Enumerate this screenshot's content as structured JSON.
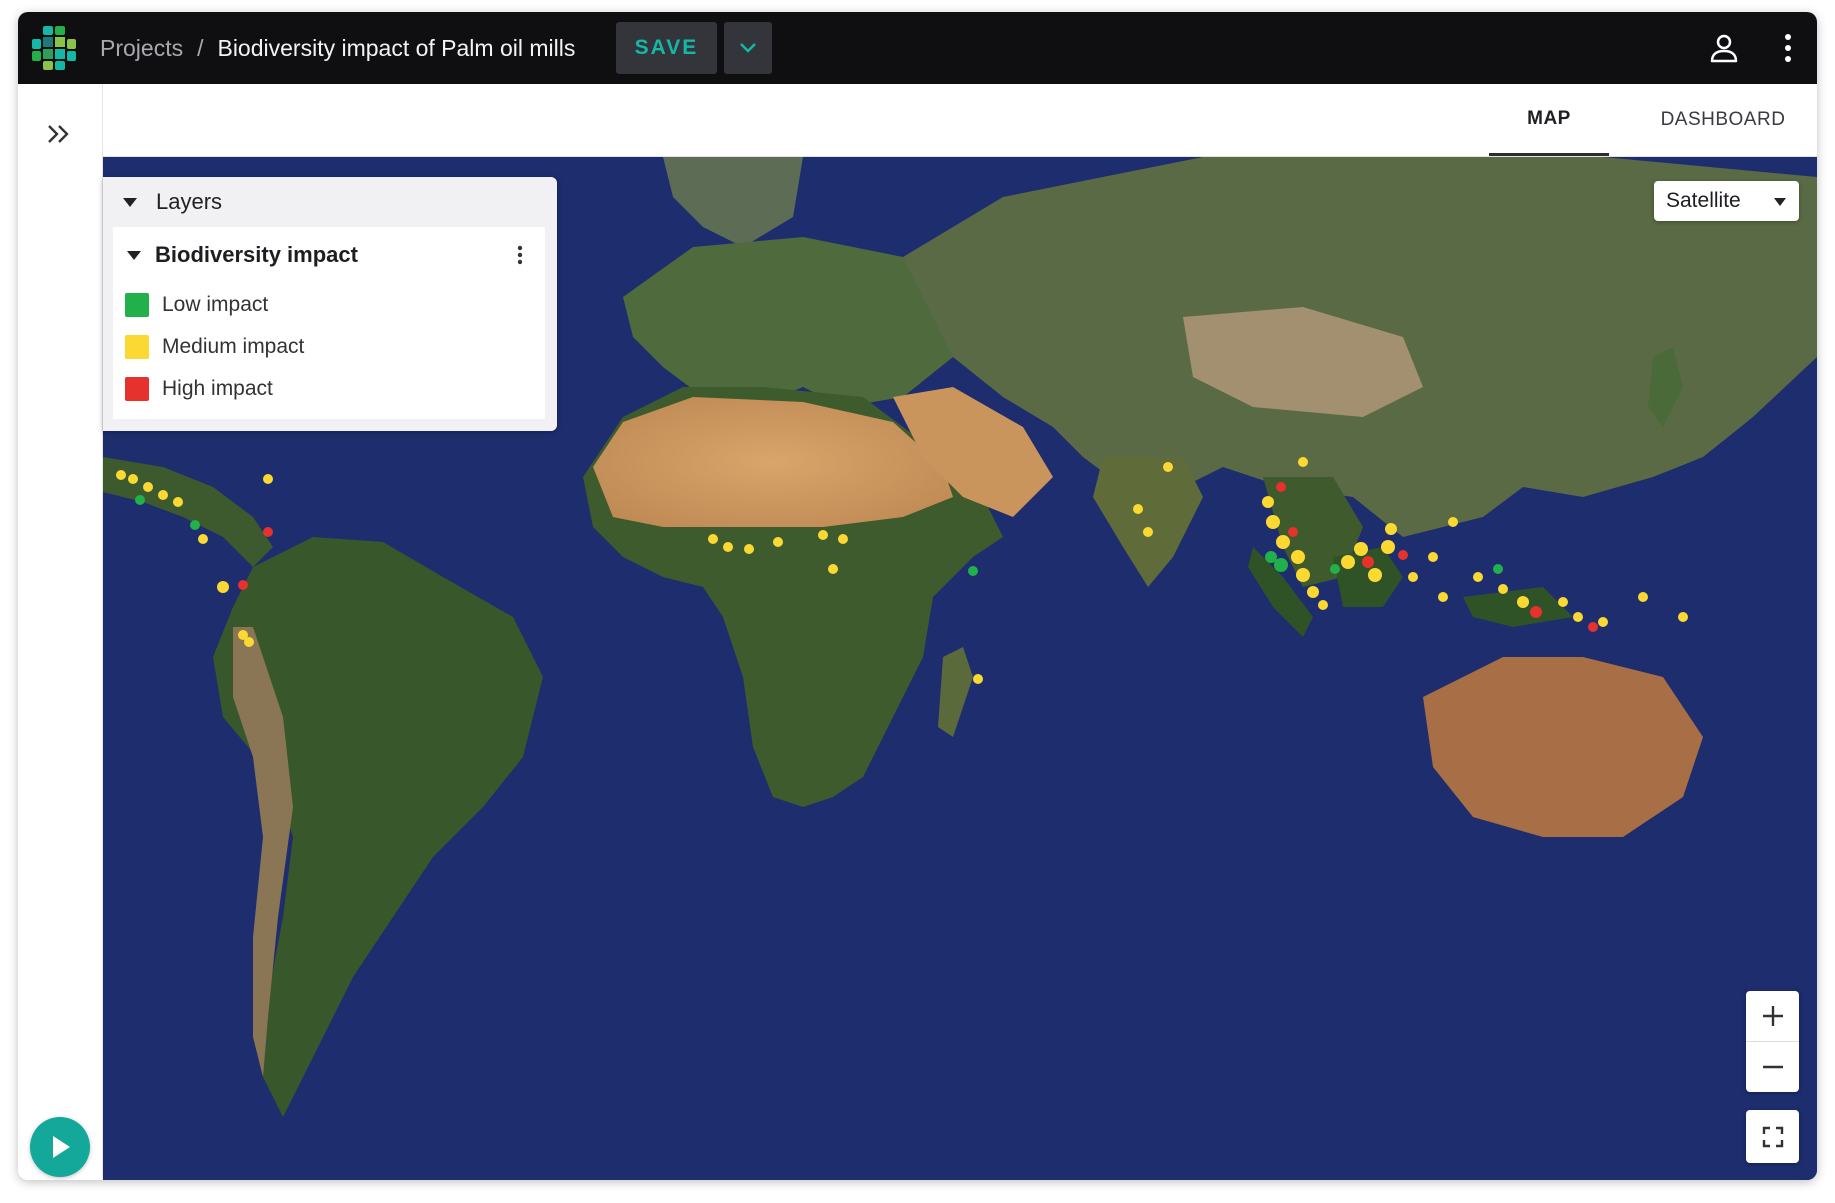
{
  "header": {
    "breadcrumb_projects": "Projects",
    "breadcrumb_separator": "/",
    "project_title": "Biodiversity impact of Palm oil mills",
    "save_label": "SAVE"
  },
  "tabs": [
    {
      "label": "MAP",
      "active": true
    },
    {
      "label": "DASHBOARD",
      "active": false
    }
  ],
  "layers_panel": {
    "title": "Layers",
    "layer": {
      "name": "Biodiversity impact",
      "legend": [
        {
          "label": "Low impact",
          "color": "#22b04b"
        },
        {
          "label": "Medium impact",
          "color": "#fcd932"
        },
        {
          "label": "High impact",
          "color": "#e5322d"
        }
      ]
    }
  },
  "basemap": {
    "selected": "Satellite"
  },
  "colors": {
    "accent": "#14b8a6",
    "topbar": "#0f0f12",
    "ocean": "#1d2d6e"
  },
  "icons": {
    "logo": "app-logo-icon",
    "save_dropdown": "chevron-down-icon",
    "user": "user-icon",
    "menu": "more-vertical-icon",
    "sidebar_toggle": "double-chevron-right-icon",
    "play": "play-icon",
    "zoom_in": "plus-icon",
    "zoom_out": "minus-icon",
    "fullscreen": "fullscreen-icon"
  }
}
